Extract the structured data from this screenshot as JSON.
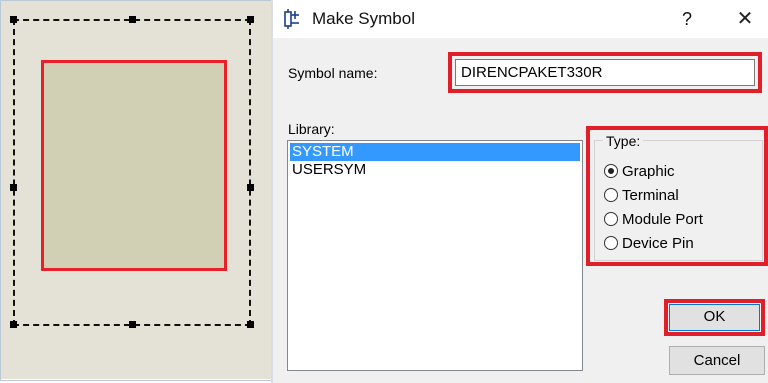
{
  "dialog": {
    "title": "Make Symbol",
    "help_label": "?",
    "close_label": "✕",
    "symbol_name_label": "Symbol name:",
    "symbol_name_value": "DIRENCPAKET330R",
    "library_label": "Library:",
    "library_items": [
      "SYSTEM",
      "USERSYM"
    ],
    "selected_library": "SYSTEM",
    "type_label": "Type:",
    "type_options": [
      "Graphic",
      "Terminal",
      "Module Port",
      "Device Pin"
    ],
    "selected_type": "Graphic",
    "ok_label": "OK",
    "cancel_label": "Cancel"
  },
  "colors": {
    "highlight_red": "#e01f2b",
    "selection_blue": "#3399ff",
    "canvas_bg": "#e4e2d6",
    "shape_fill": "#d1cfb4"
  },
  "icons": {
    "app_icon": "symbol-icon",
    "close_icon": "close-icon"
  }
}
